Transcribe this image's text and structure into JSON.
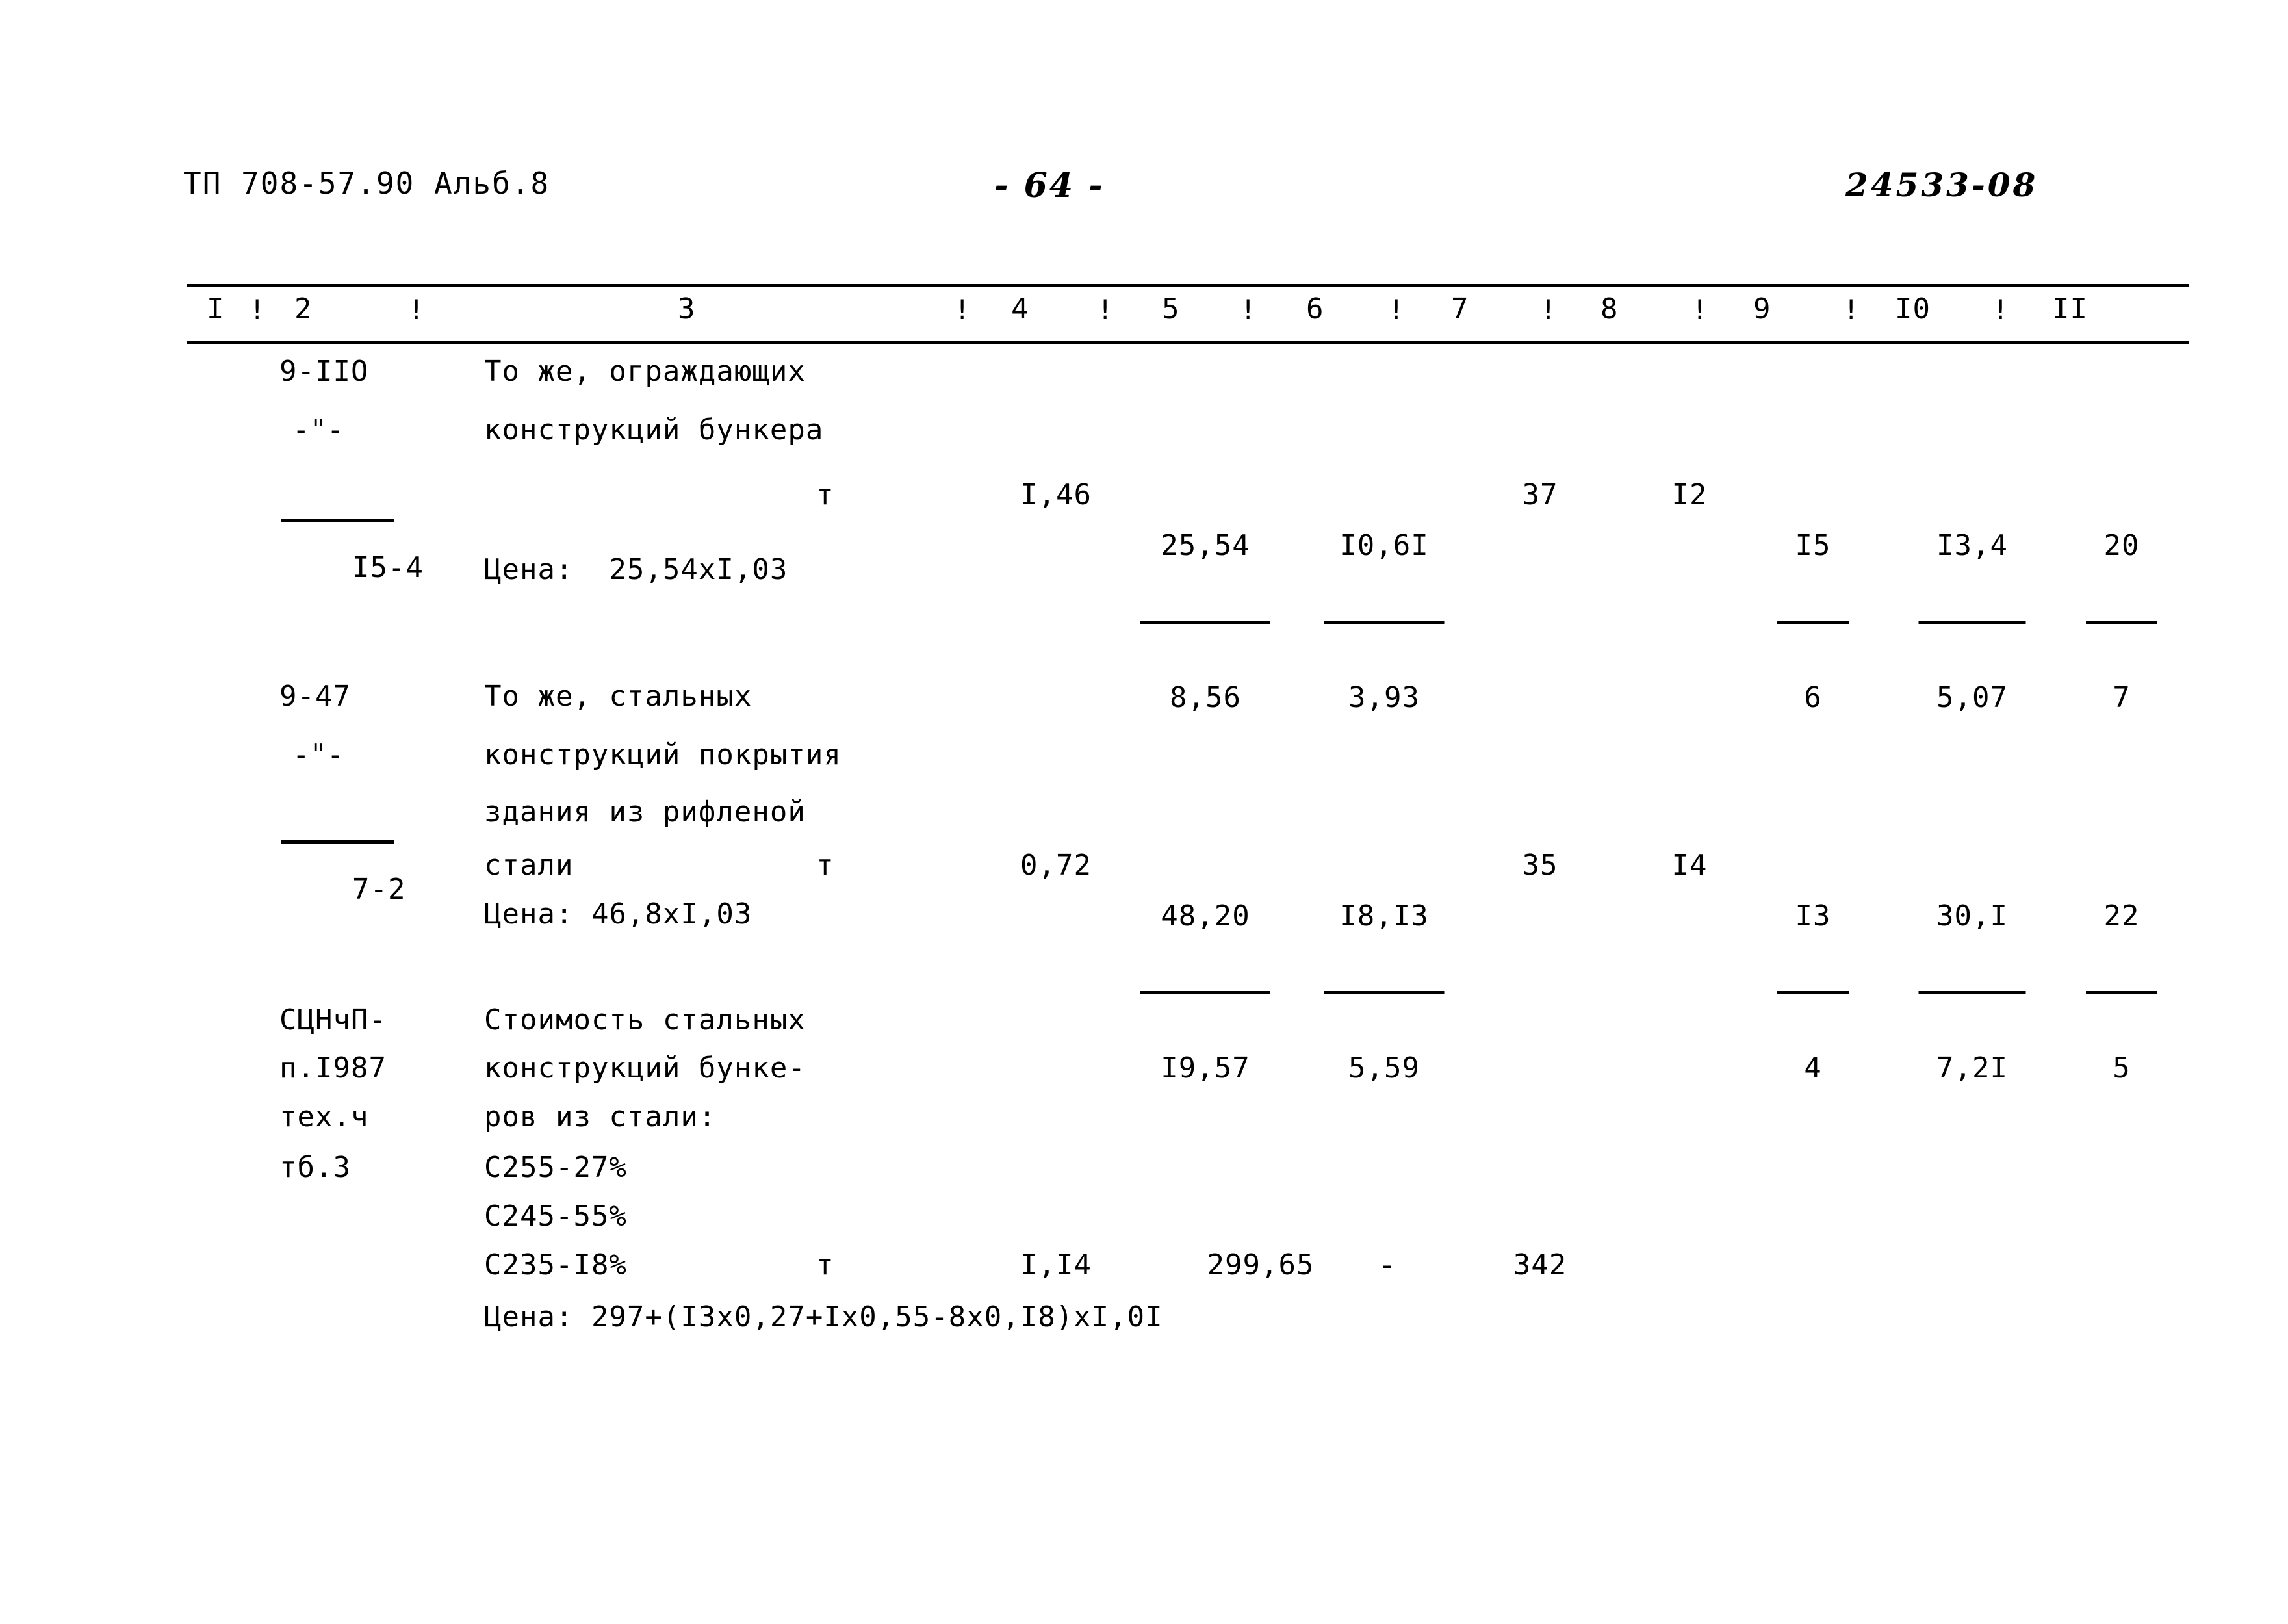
{
  "header": {
    "document_code": "ТП 708-57.90 Альб.8",
    "page_number": "- 64 -",
    "stamp": "24533-08"
  },
  "table": {
    "column_headers": [
      "I",
      "2",
      "3",
      "4",
      "5",
      "6",
      "7",
      "8",
      "9",
      "I0",
      "II"
    ],
    "separator": "!",
    "rows": [
      {
        "code_lines": [
          "9-IIO",
          "-\"-",
          "I5-4"
        ],
        "code_overline_index": 2,
        "description_lines": [
          "То же, ограждающих",
          "конструкций бункера"
        ],
        "unit": "т",
        "col4": "I,46",
        "col5": {
          "numerator": "25,54",
          "denominator": "8,56"
        },
        "col6": {
          "numerator": "I0,6I",
          "denominator": "3,93"
        },
        "col7": "37",
        "col8": "I2",
        "col9": {
          "numerator": "I5",
          "denominator": "6"
        },
        "col10": {
          "numerator": "I3,4",
          "denominator": "5,07"
        },
        "col11": {
          "numerator": "20",
          "denominator": "7"
        },
        "price_note": "Цена:  25,54xI,03"
      },
      {
        "code_lines": [
          "9-47",
          "-\"-",
          "7-2"
        ],
        "code_overline_index": 2,
        "description_lines": [
          "То же, стальных",
          "конструкций покрытия",
          "здания из рифленой",
          "стали"
        ],
        "unit": "т",
        "col4": "0,72",
        "col5": {
          "numerator": "48,20",
          "denominator": "I9,57"
        },
        "col6": {
          "numerator": "I8,I3",
          "denominator": "5,59"
        },
        "col7": "35",
        "col8": "I4",
        "col9": {
          "numerator": "I3",
          "denominator": "4"
        },
        "col10": {
          "numerator": "30,I",
          "denominator": "7,2I"
        },
        "col11": {
          "numerator": "22",
          "denominator": "5"
        },
        "price_note": "Цена: 46,8xI,03"
      },
      {
        "code_lines": [
          "СЦНчП-",
          "п.I987",
          "тех.ч",
          "тб.3"
        ],
        "code_overline_index": -1,
        "description_lines": [
          "Стоимость стальных",
          "конструкций бунке-",
          "ров из стали:",
          "С255-27%",
          "С245-55%",
          "С235-I8%"
        ],
        "unit": "т",
        "col4": "I,I4",
        "col5": "299,65",
        "col6": "-",
        "col7": "342",
        "price_note": "Цена: 297+(I3x0,27+Ix0,55-8x0,I8)xI,0I"
      }
    ]
  }
}
